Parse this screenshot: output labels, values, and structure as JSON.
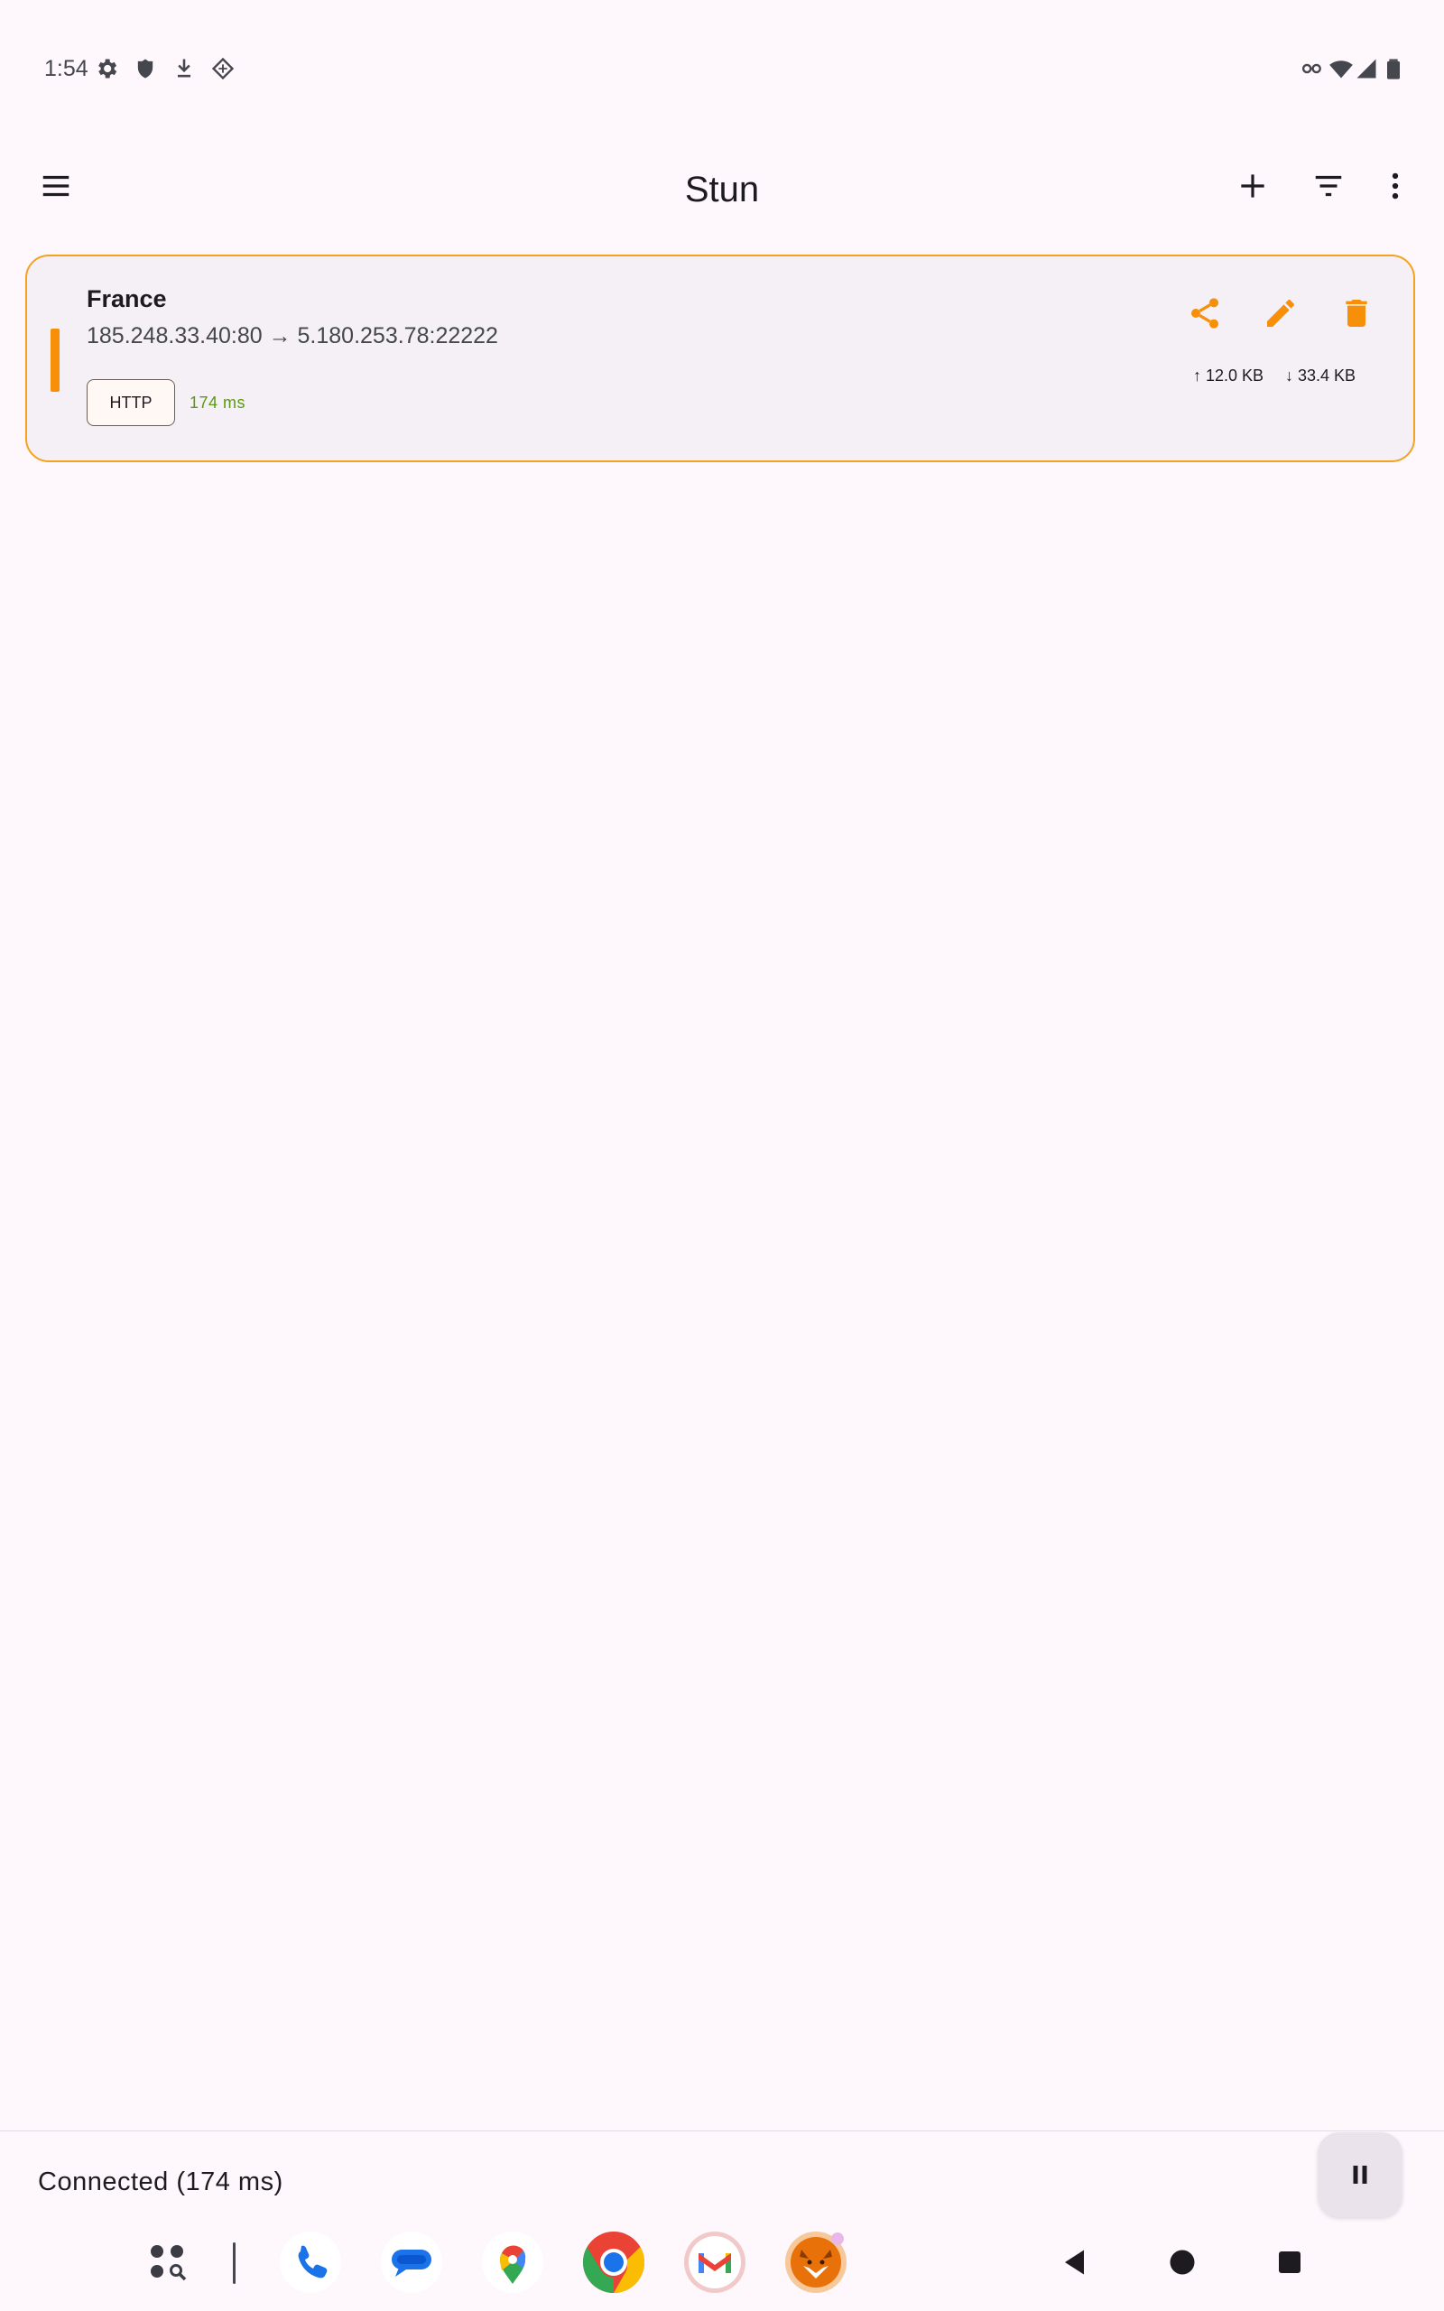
{
  "status_bar": {
    "time": "1:54",
    "left_icons": [
      "settings-icon",
      "shield-icon",
      "download-arrow-icon",
      "diamond-icon"
    ],
    "right_icons": [
      "vpn-key-icon",
      "wifi-icon",
      "cell-signal-icon",
      "battery-icon"
    ]
  },
  "app_bar": {
    "title": "Stun",
    "menu_icon": "hamburger-menu-icon",
    "actions": [
      "add-icon",
      "filter-icon",
      "more-vert-icon"
    ]
  },
  "profile": {
    "name": "France",
    "route": "185.248.33.40:80 → 5.180.253.78:22222",
    "protocol": "HTTP",
    "latency": "174 ms",
    "upload": "↑ 12.0 KB",
    "download": "↓ 33.4 KB",
    "actions": [
      "share-icon",
      "edit-icon",
      "delete-icon"
    ]
  },
  "connection": {
    "status": "Connected (174 ms)",
    "control_icon": "pause-icon"
  },
  "taskbar": {
    "apps": [
      "all-apps-search-icon",
      "phone-app-icon",
      "messages-app-icon",
      "maps-app-icon",
      "chrome-app-icon",
      "gmail-app-icon",
      "fox-app-icon"
    ],
    "nav": [
      "back-icon",
      "home-icon",
      "recents-icon"
    ]
  },
  "colors": {
    "accent": "#f78f08",
    "card_border": "#f5a21f",
    "background": "#fef7fc",
    "card_background": "#f4f0f5",
    "latency_green": "#5a9a10"
  }
}
